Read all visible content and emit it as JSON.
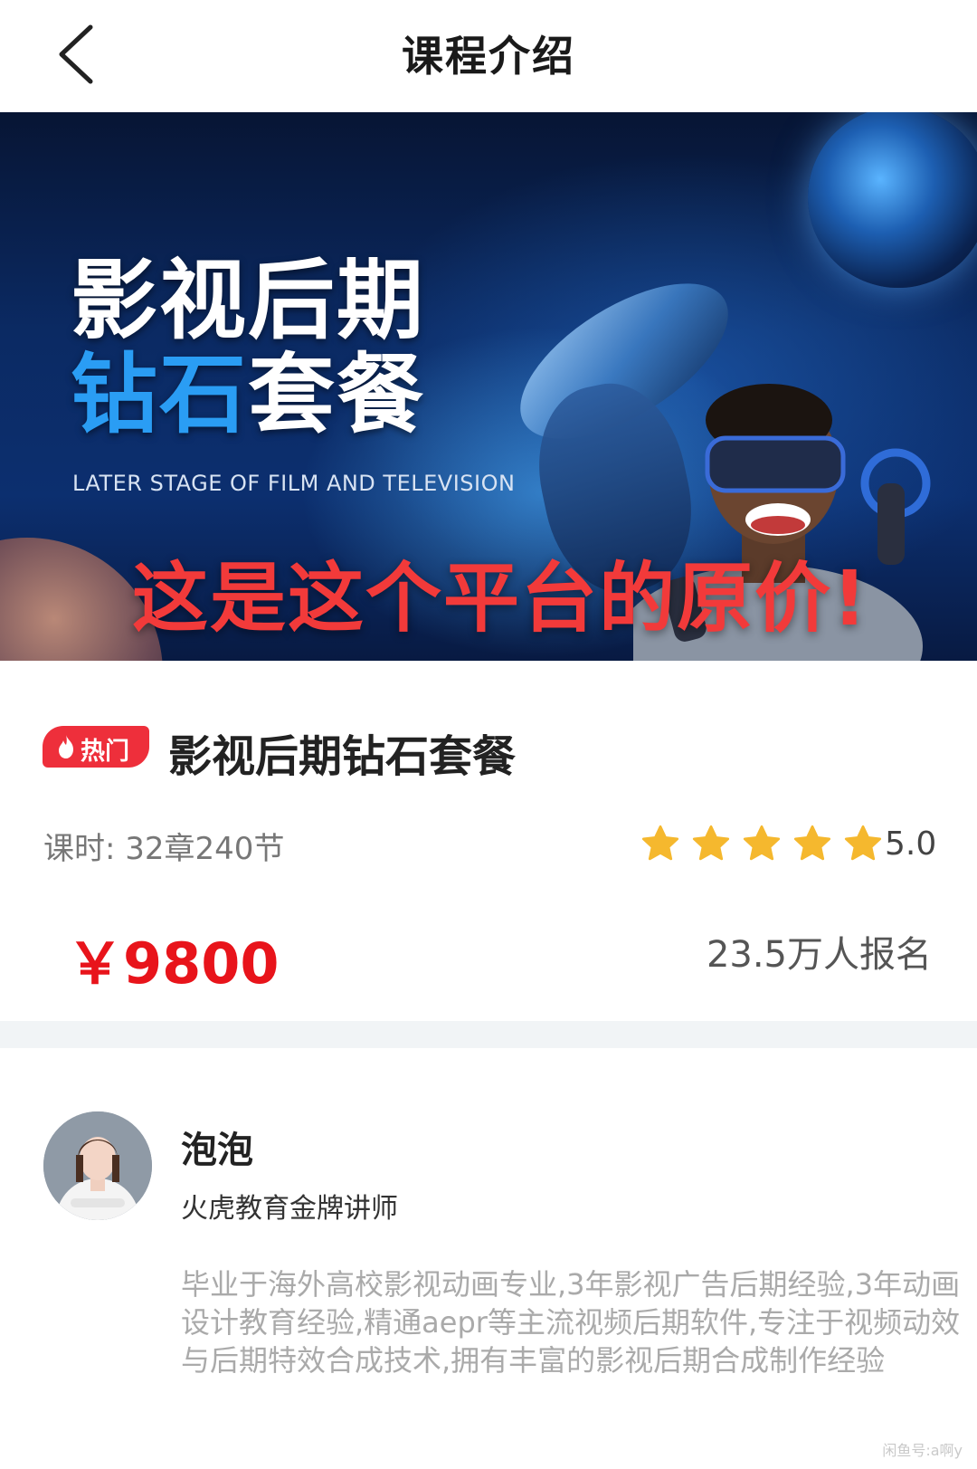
{
  "header": {
    "title": "课程介绍"
  },
  "banner": {
    "title_line1": "影视后期",
    "title_line2_blue": "钻石",
    "title_line2_white": "套餐",
    "english": "LATER STAGE OF FILM AND TELEVISION",
    "red_caption": "这是这个平台的原价!"
  },
  "course": {
    "badge": "热门",
    "title": "影视后期钻石套餐",
    "hours_label": "课时:",
    "hours_value": "32章240节",
    "rating": "5.0",
    "stars": 5,
    "price": "￥9800",
    "enrolled": "23.5万人报名"
  },
  "teacher": {
    "name": "泡泡",
    "role": "火虎教育金牌讲师",
    "bio": "毕业于海外高校影视动画专业,3年影视广告后期经验,3年动画设计教育经验,精通aepr等主流视频后期软件,专注于视频动效与后期特效合成技术,拥有丰富的影视后期合成制作经验"
  },
  "watermark": "闲鱼号:a啊y",
  "colors": {
    "accent_red": "#e8141b",
    "star": "#f5b82e",
    "badge_red": "#ee2f3b"
  }
}
